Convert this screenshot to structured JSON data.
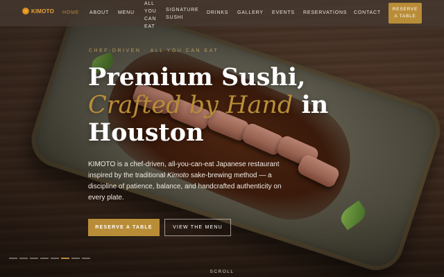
{
  "nav": {
    "brand": "KIMOTO",
    "links": [
      "HOME",
      "ABOUT",
      "MENU",
      "SIGNATURE SUSHI",
      "DRINKS",
      "GALLERY",
      "EVENTS",
      "RESERVATIONS",
      "CONTACT"
    ],
    "ayce_lines": [
      "ALL",
      "YOU",
      "CAN",
      "EAT"
    ],
    "reserve_lines": [
      "RESERVE",
      "A TABLE"
    ]
  },
  "hero": {
    "kicker": "CHEF-DRIVEN · ALL YOU CAN EAT",
    "title_line1": "Premium Sushi,",
    "title_accent": "Crafted by Hand",
    "title_in": " in",
    "title_line3": "Houston",
    "desc_before": "KIMOTO is a chef-driven, all-you-can-eat Japanese restaurant inspired by the traditional ",
    "desc_em": "Kimoto",
    "desc_after": " sake-brewing method — a discipline of patience, balance, and handcrafted authenticity on every plate.",
    "primary_cta": "RESERVE A TABLE",
    "secondary_cta": "VIEW THE MENU",
    "scroll_label": "SCROLL"
  },
  "slider": {
    "count": 8,
    "active_index": 5
  },
  "colors": {
    "accent": "#b98d38",
    "nav_bg": "#463a32",
    "text": "#ffffff"
  }
}
